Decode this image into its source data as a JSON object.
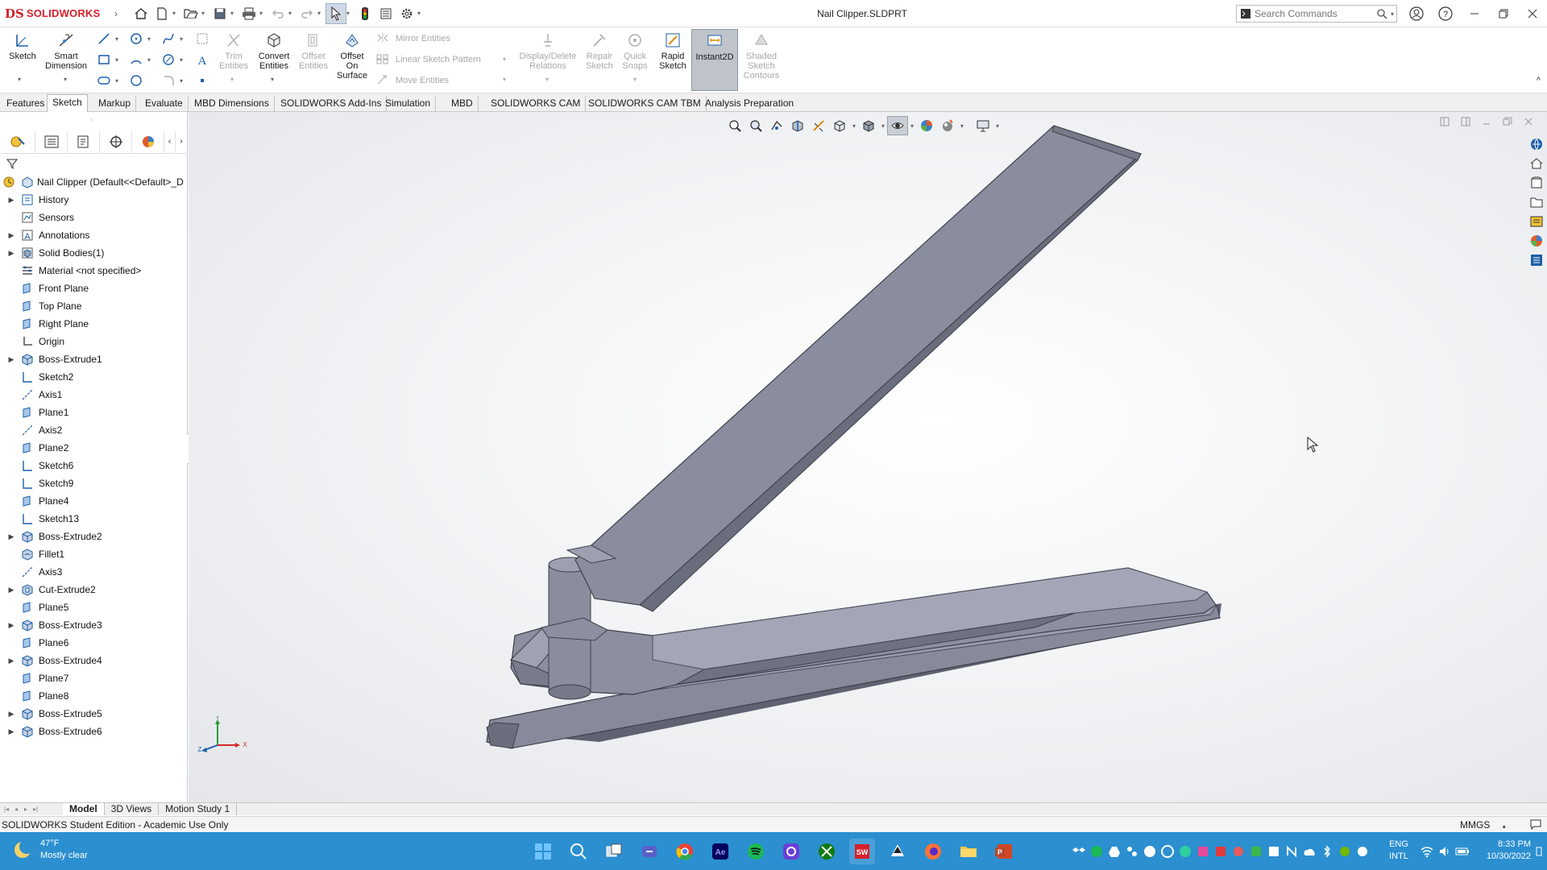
{
  "app": {
    "logo_ds": "DS",
    "logo_text": "SOLIDWORKS",
    "title": "Nail Clipper.SLDPRT",
    "search_placeholder": "Search Commands"
  },
  "ribbon": {
    "sketch": "Sketch",
    "smart_dimension_1": "Smart",
    "smart_dimension_2": "Dimension",
    "trim_1": "Trim",
    "trim_2": "Entities",
    "convert_1": "Convert",
    "convert_2": "Entities",
    "offset_1": "Offset",
    "offset_2": "Entities",
    "offset_surface_1": "Offset",
    "offset_surface_2": "On",
    "offset_surface_3": "Surface",
    "mirror": "Mirror Entities",
    "linear_pattern": "Linear Sketch Pattern",
    "move": "Move Entities",
    "display_delete_1": "Display/Delete",
    "display_delete_2": "Relations",
    "repair_1": "Repair",
    "repair_2": "Sketch",
    "quick_snaps_1": "Quick",
    "quick_snaps_2": "Snaps",
    "rapid_1": "Rapid",
    "rapid_2": "Sketch",
    "instant2d": "Instant2D",
    "shaded_1": "Shaded",
    "shaded_2": "Sketch",
    "shaded_3": "Contours"
  },
  "command_tabs": [
    "Features",
    "Sketch",
    "Markup",
    "Evaluate",
    "MBD Dimensions",
    "SOLIDWORKS Add-Ins",
    "Simulation",
    "MBD",
    "SOLIDWORKS CAM",
    "SOLIDWORKS CAM TBM",
    "Analysis Preparation"
  ],
  "active_command_tab": "Sketch",
  "tree": {
    "root": "Nail Clipper  (Default<<Default>_D",
    "items": [
      {
        "label": "History",
        "expand": true,
        "icon": "history-icon"
      },
      {
        "label": "Sensors",
        "expand": false,
        "icon": "sensors-icon"
      },
      {
        "label": "Annotations",
        "expand": true,
        "icon": "annotations-icon"
      },
      {
        "label": "Solid Bodies(1)",
        "expand": true,
        "icon": "solid-bodies-icon"
      },
      {
        "label": "Material <not specified>",
        "expand": false,
        "icon": "material-icon"
      },
      {
        "label": "Front Plane",
        "expand": false,
        "icon": "plane-icon"
      },
      {
        "label": "Top Plane",
        "expand": false,
        "icon": "plane-icon"
      },
      {
        "label": "Right Plane",
        "expand": false,
        "icon": "plane-icon"
      },
      {
        "label": "Origin",
        "expand": false,
        "icon": "origin-icon"
      },
      {
        "label": "Boss-Extrude1",
        "expand": true,
        "icon": "extrude-icon"
      },
      {
        "label": "Sketch2",
        "expand": false,
        "icon": "sketch-icon"
      },
      {
        "label": "Axis1",
        "expand": false,
        "icon": "axis-icon"
      },
      {
        "label": "Plane1",
        "expand": false,
        "icon": "plane-icon"
      },
      {
        "label": "Axis2",
        "expand": false,
        "icon": "axis-icon"
      },
      {
        "label": "Plane2",
        "expand": false,
        "icon": "plane-icon"
      },
      {
        "label": "Sketch6",
        "expand": false,
        "icon": "sketch-icon"
      },
      {
        "label": "Sketch9",
        "expand": false,
        "icon": "sketch-icon"
      },
      {
        "label": "Plane4",
        "expand": false,
        "icon": "plane-icon"
      },
      {
        "label": "Sketch13",
        "expand": false,
        "icon": "sketch-icon"
      },
      {
        "label": "Boss-Extrude2",
        "expand": true,
        "icon": "extrude-icon"
      },
      {
        "label": "Fillet1",
        "expand": false,
        "icon": "fillet-icon"
      },
      {
        "label": "Axis3",
        "expand": false,
        "icon": "axis-icon"
      },
      {
        "label": "Cut-Extrude2",
        "expand": true,
        "icon": "cut-extrude-icon"
      },
      {
        "label": "Plane5",
        "expand": false,
        "icon": "plane-icon"
      },
      {
        "label": "Boss-Extrude3",
        "expand": true,
        "icon": "extrude-icon"
      },
      {
        "label": "Plane6",
        "expand": false,
        "icon": "plane-icon"
      },
      {
        "label": "Boss-Extrude4",
        "expand": true,
        "icon": "extrude-icon"
      },
      {
        "label": "Plane7",
        "expand": false,
        "icon": "plane-icon"
      },
      {
        "label": "Plane8",
        "expand": false,
        "icon": "plane-icon"
      },
      {
        "label": "Boss-Extrude5",
        "expand": true,
        "icon": "extrude-icon"
      },
      {
        "label": "Boss-Extrude6",
        "expand": true,
        "icon": "extrude-icon"
      }
    ]
  },
  "triad": {
    "y": "Y",
    "x": "X",
    "z": "Z"
  },
  "bottom_tabs": [
    "Model",
    "3D Views",
    "Motion Study 1"
  ],
  "active_bottom_tab": "Model",
  "status": {
    "text": "SOLIDWORKS Student Edition - Academic Use Only",
    "units": "MMGS"
  },
  "taskbar": {
    "temp": "47°F",
    "weather": "Mostly clear",
    "lang_1": "ENG",
    "lang_2": "INTL",
    "time": "8:33 PM",
    "date": "10/30/2022"
  },
  "colors": {
    "brand_red": "#d6202a",
    "taskbar_blue": "#2b8fd0",
    "model_gray": "#8a8d9c",
    "tree_highlight": "#3a7fc9"
  }
}
